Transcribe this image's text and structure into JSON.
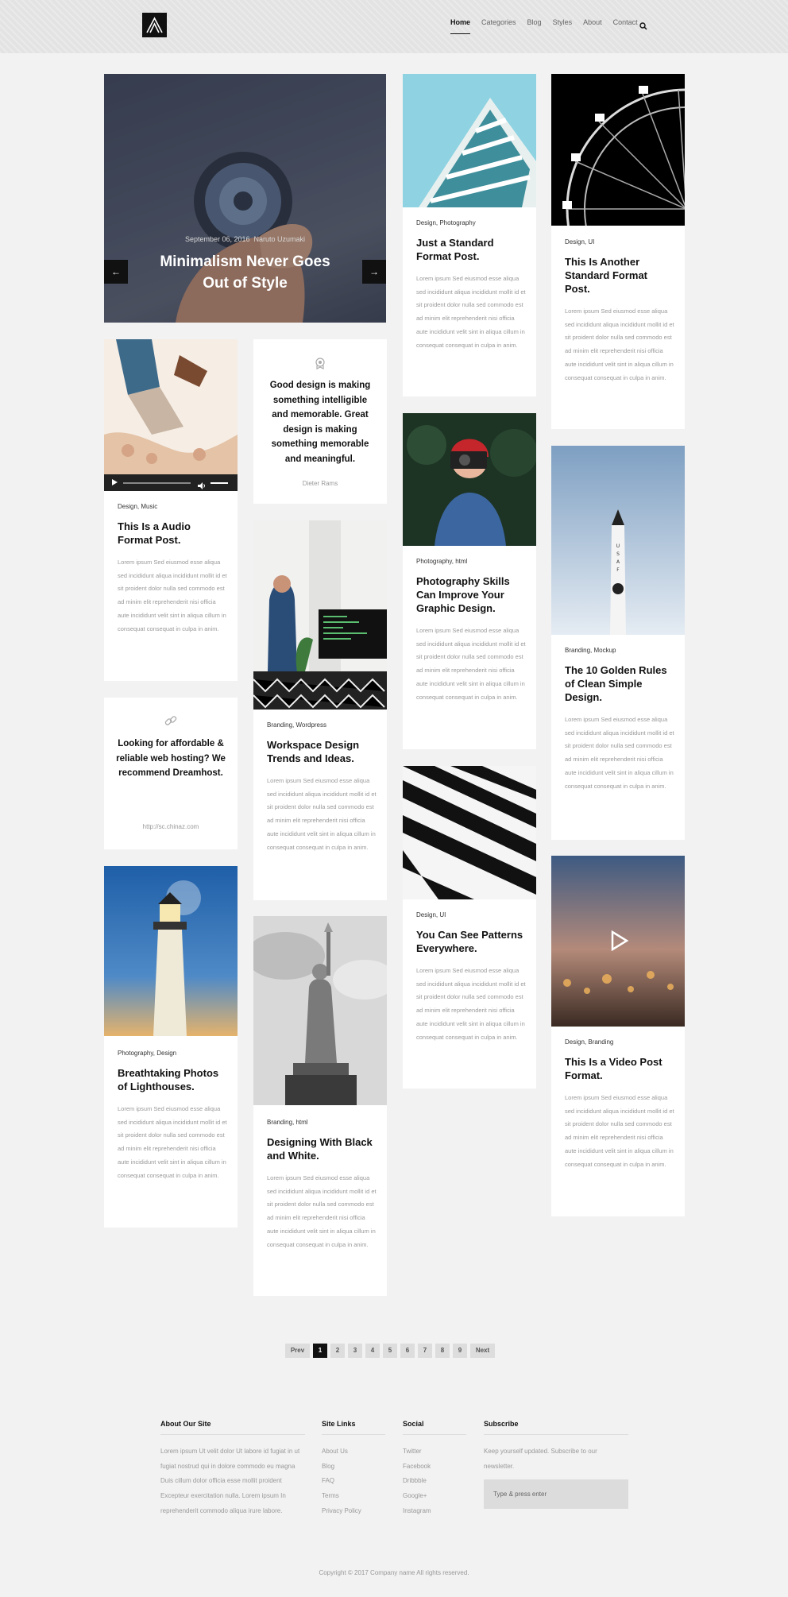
{
  "header": {
    "nav": [
      "Home",
      "Categories",
      "Blog",
      "Styles",
      "About",
      "Contact"
    ]
  },
  "slider": {
    "date": "September 06, 2016",
    "author": "Naruto Uzumaki",
    "title": "Minimalism Never Goes Out of Style",
    "prev_arrow": "←",
    "next_arrow": "→"
  },
  "posts": [
    {
      "category": "Design, Photography",
      "title": "Just a Standard Format Post.",
      "excerpt": "Lorem ipsum Sed eiusmod esse aliqua sed incididunt aliqua incididunt mollit id et sit proident dolor nulla sed commodo est ad minim elit reprehenderit nisi officia aute incididunt velit sint in aliqua cillum in consequat consequat in culpa in anim."
    },
    {
      "category": "Design, UI",
      "title": "This Is Another Standard Format Post.",
      "excerpt": "Lorem ipsum Sed eiusmod esse aliqua sed incididunt aliqua incididunt mollit id et sit proident dolor nulla sed commodo est ad minim elit reprehenderit nisi officia aute incididunt velit sint in aliqua cillum in consequat consequat in culpa in anim."
    },
    {
      "category": "Design, Music",
      "title": "This Is a Audio Format Post.",
      "excerpt": "Lorem ipsum Sed eiusmod esse aliqua sed incididunt aliqua incididunt mollit id et sit proident dolor nulla sed commodo est ad minim elit reprehenderit nisi officia aute incididunt velit sint in aliqua cillum in consequat consequat in culpa in anim."
    },
    {
      "category": "Photography, html",
      "title": "Photography Skills Can Improve Your Graphic Design.",
      "excerpt": "Lorem ipsum Sed eiusmod esse aliqua sed incididunt aliqua incididunt mollit id et sit proident dolor nulla sed commodo est ad minim elit reprehenderit nisi officia aute incididunt velit sint in aliqua cillum in consequat consequat in culpa in anim."
    },
    {
      "category": "Branding, Mockup",
      "title": "The 10 Golden Rules of Clean Simple Design.",
      "excerpt": "Lorem ipsum Sed eiusmod esse aliqua sed incididunt aliqua incididunt mollit id et sit proident dolor nulla sed commodo est ad minim elit reprehenderit nisi officia aute incididunt velit sint in aliqua cillum in consequat consequat in culpa in anim."
    },
    {
      "category": "Branding, Wordpress",
      "title": "Workspace Design Trends and Ideas.",
      "excerpt": "Lorem ipsum Sed eiusmod esse aliqua sed incididunt aliqua incididunt mollit id et sit proident dolor nulla sed commodo est ad minim elit reprehenderit nisi officia aute incididunt velit sint in aliqua cillum in consequat consequat in culpa in anim."
    },
    {
      "category": "Design, UI",
      "title": "You Can See Patterns Everywhere.",
      "excerpt": "Lorem ipsum Sed eiusmod esse aliqua sed incididunt aliqua incididunt mollit id et sit proident dolor nulla sed commodo est ad minim elit reprehenderit nisi officia aute incididunt velit sint in aliqua cillum in consequat consequat in culpa in anim."
    },
    {
      "category": "Photography, Design",
      "title": "Breathtaking Photos of Lighthouses.",
      "excerpt": "Lorem ipsum Sed eiusmod esse aliqua sed incididunt aliqua incididunt mollit id et sit proident dolor nulla sed commodo est ad minim elit reprehenderit nisi officia aute incididunt velit sint in aliqua cillum in consequat consequat in culpa in anim."
    },
    {
      "category": "Design, Branding",
      "title": "This Is a Video Post Format.",
      "excerpt": "Lorem ipsum Sed eiusmod esse aliqua sed incididunt aliqua incididunt mollit id et sit proident dolor nulla sed commodo est ad minim elit reprehenderit nisi officia aute incididunt velit sint in aliqua cillum in consequat consequat in culpa in anim."
    },
    {
      "category": "Branding, html",
      "title": "Designing With Black and White.",
      "excerpt": "Lorem ipsum Sed eiusmod esse aliqua sed incididunt aliqua incididunt mollit id et sit proident dolor nulla sed commodo est ad minim elit reprehenderit nisi officia aute incididunt velit sint in aliqua cillum in consequat consequat in culpa in anim."
    }
  ],
  "quote": {
    "text": "Good design is making something intelligible and memorable. Great design is making something memorable and meaningful.",
    "source": "Dieter Rams"
  },
  "link_post": {
    "text": "Looking for affordable & reliable web hosting? We recommend Dreamhost.",
    "url": "http://sc.chinaz.com"
  },
  "pagination": {
    "prev": "Prev",
    "next": "Next",
    "pages": [
      "1",
      "2",
      "3",
      "4",
      "5",
      "6",
      "7",
      "8",
      "9"
    ],
    "current": "1"
  },
  "footer": {
    "about_title": "About Our Site",
    "about_text": "Lorem ipsum Ut velit dolor Ut labore id fugiat in ut fugiat nostrud qui in dolore commodo eu magna Duis cillum dolor officia esse mollit proident Excepteur exercitation nulla. Lorem ipsum In reprehenderit commodo aliqua irure labore.",
    "site_links_title": "Site Links",
    "site_links": [
      "About Us",
      "Blog",
      "FAQ",
      "Terms",
      "Privacy Policy"
    ],
    "social_title": "Social",
    "social_links": [
      "Twitter",
      "Facebook",
      "Dribbble",
      "Google+",
      "Instagram"
    ],
    "subscribe_title": "Subscribe",
    "subscribe_text": "Keep yourself updated. Subscribe to our newsletter.",
    "subscribe_placeholder": "Type & press enter",
    "copyright": "Copyright © 2017 Company name All rights reserved."
  },
  "colors": {
    "accent": "#111111",
    "background": "#f2f2f2",
    "header_bg": "#e3e3e3",
    "muted_text": "#999999"
  }
}
